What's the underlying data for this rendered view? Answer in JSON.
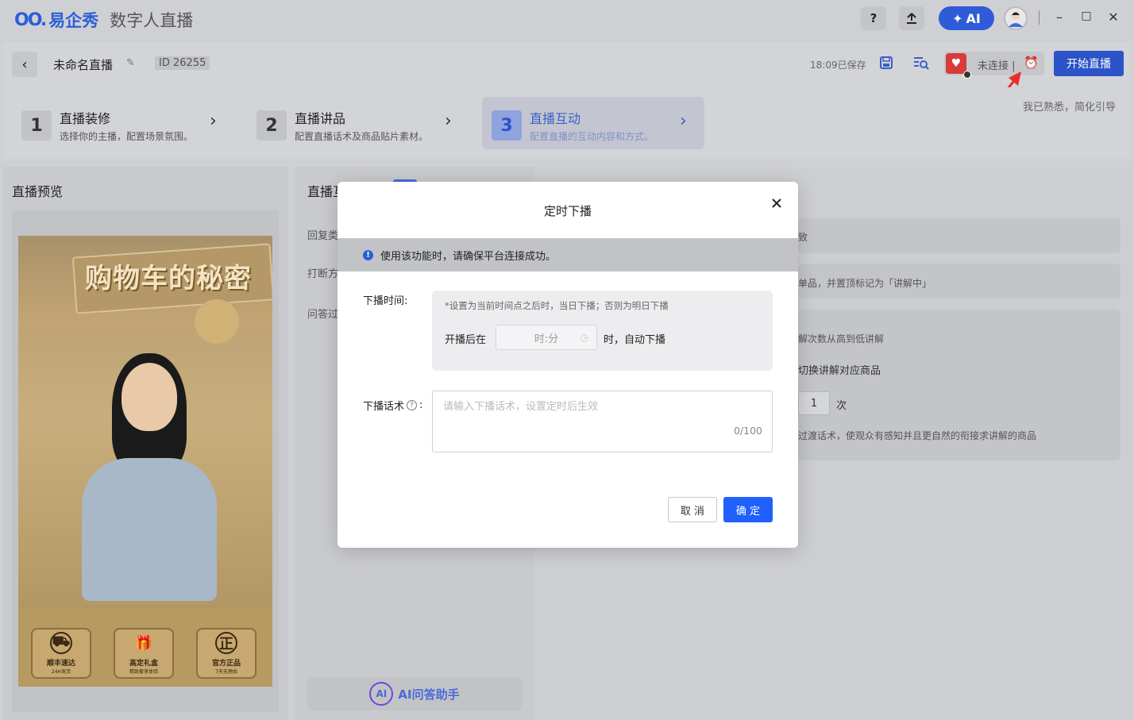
{
  "app": {
    "logo_mark": "OO.",
    "logo_text": "易企秀",
    "subtitle": "数字人直播"
  },
  "titlebar": {
    "help": "?",
    "upload_icon": "upload-icon",
    "ai_label": "AI",
    "minimize": "–",
    "maximize": "□",
    "close": "✕"
  },
  "header": {
    "back": "‹",
    "title": "未命名直播",
    "id_label": "ID",
    "id_value": "26255",
    "saved": "18:09已保存",
    "platform_status": "未连接 |",
    "start_label": "开始直播"
  },
  "steps": [
    {
      "num": "1",
      "title": "直播装修",
      "desc": "选择你的主播，配置场景氛围。"
    },
    {
      "num": "2",
      "title": "直播讲品",
      "desc": "配置直播话术及商品贴片素材。"
    },
    {
      "num": "3",
      "title": "直播互动",
      "desc": "配置直播的互动内容和方式。"
    }
  ],
  "familiar_hint": "我已熟悉，简化引导",
  "preview": {
    "title": "直播预览",
    "banner": "购物车的秘密",
    "features": [
      {
        "title": "顺丰速达",
        "sub": "24H发货"
      },
      {
        "title": "高定礼盒",
        "sub": "精致奢享体验"
      },
      {
        "title": "官方正品",
        "sub": "7天无理由"
      }
    ]
  },
  "middle": {
    "tab": "直播互",
    "items": [
      "回复类",
      "打断方",
      "问答过"
    ],
    "ai_assist": "AI问答助手"
  },
  "right": {
    "row1": "致",
    "row2": "单品，并置顶标记为「讲解中」",
    "row3": "解次数从高到低讲解",
    "row4": "切换讲解对应商品",
    "count_value": "1",
    "count_unit": "次",
    "row5": "过渡话术，使观众有感知并且更自然的衔接求讲解的商品"
  },
  "modal": {
    "title": "定时下播",
    "alert": "使用该功能时，请确保平台连接成功。",
    "time_label": "下播时间:",
    "hint": "*设置为当前时间点之后时，当日下播；否则为明日下播",
    "prefix": "开播后在",
    "time_placeholder": "时:分",
    "suffix": "时，自动下播",
    "speech_label": "下播话术",
    "speech_placeholder": "请输入下播话术，设置定时后生效",
    "counter": "0/100",
    "cancel": "取 消",
    "confirm": "确 定"
  },
  "colors": {
    "accent": "#1f60ff",
    "brand": "#2b5fd9",
    "annotation_arrow": "#e8302a"
  }
}
